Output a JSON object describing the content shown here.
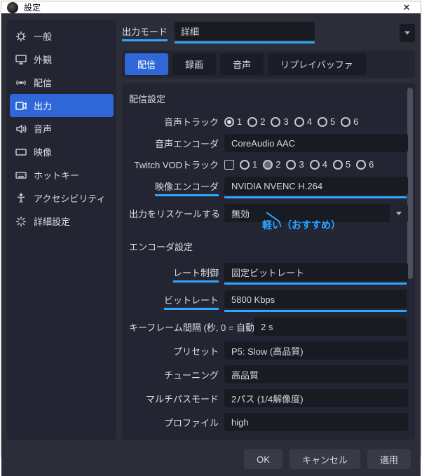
{
  "window": {
    "title": "設定"
  },
  "sidebar": {
    "items": [
      {
        "icon": "gear-icon",
        "label": "一般"
      },
      {
        "icon": "monitor-icon",
        "label": "外観"
      },
      {
        "icon": "antenna-icon",
        "label": "配信"
      },
      {
        "icon": "output-icon",
        "label": "出力"
      },
      {
        "icon": "speaker-icon",
        "label": "音声"
      },
      {
        "icon": "video-icon",
        "label": "映像"
      },
      {
        "icon": "keyboard-icon",
        "label": "ホットキー"
      },
      {
        "icon": "accessibility-icon",
        "label": "アクセシビリティ"
      },
      {
        "icon": "wrench-icon",
        "label": "詳細設定"
      }
    ],
    "active_index": 3
  },
  "output_mode": {
    "label": "出力モード",
    "value": "詳細"
  },
  "tabs": [
    {
      "label": "配信"
    },
    {
      "label": "録画"
    },
    {
      "label": "音声"
    },
    {
      "label": "リプレイバッファ"
    }
  ],
  "tabs_active": 0,
  "stream": {
    "group_title": "配信設定",
    "audio_track_label": "音声トラック",
    "audio_track": {
      "options": [
        "1",
        "2",
        "3",
        "4",
        "5",
        "6"
      ],
      "selected": 0
    },
    "audio_encoder_label": "音声エンコーダ",
    "audio_encoder": "CoreAudio AAC",
    "twitch_vod_label": "Twitch VODトラック",
    "twitch_vod_enabled": false,
    "twitch_vod": {
      "options": [
        "1",
        "2",
        "3",
        "4",
        "5",
        "6"
      ],
      "selected": 1
    },
    "video_encoder_label": "映像エンコーダ",
    "video_encoder": "NVIDIA NVENC H.264",
    "rescale_label": "出力をリスケールする",
    "rescale": "無効"
  },
  "annotation": {
    "text": "軽い（おすすめ）"
  },
  "encoder": {
    "group_title": "エンコーダ設定",
    "rate_control_label": "レート制御",
    "rate_control": "固定ビットレート",
    "bitrate_label": "ビットレート",
    "bitrate": "5800 Kbps",
    "keyframe_label": "キーフレーム間隔 (秒, 0 = 自動)",
    "keyframe": "2 s",
    "preset_label": "プリセット",
    "preset": "P5: Slow (高品質)",
    "tuning_label": "チューニング",
    "tuning": "高品質",
    "multipass_label": "マルチパスモード",
    "multipass": "2パス (1/4解像度)",
    "profile_label": "プロファイル",
    "profile": "high"
  },
  "footer": {
    "ok": "OK",
    "cancel": "キャンセル",
    "apply": "適用"
  }
}
